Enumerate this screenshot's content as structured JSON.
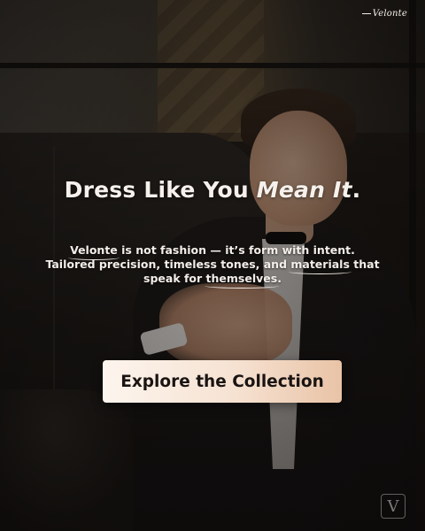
{
  "brand": {
    "name": "Velonte"
  },
  "headline": {
    "part1": "Dress Like You ",
    "emphasis": "Mean It",
    "end": "."
  },
  "body": {
    "brand_word": "Velonte",
    "line1_rest": " is not fashion — it’s form with intent.",
    "line2_a": "Tailored precision, timeless tones, and ",
    "line2_ul": "materials",
    "line2_b": " that",
    "line3_a": "speak for ",
    "line3_ul": "themselves",
    "line3_b": "."
  },
  "cta": {
    "label": "Explore the Collection"
  },
  "logo_mark": {
    "letter": "V"
  },
  "colors": {
    "cta_start": "#fdf5ee",
    "cta_end": "#e9c3a6",
    "text": "#f6f1ec"
  }
}
